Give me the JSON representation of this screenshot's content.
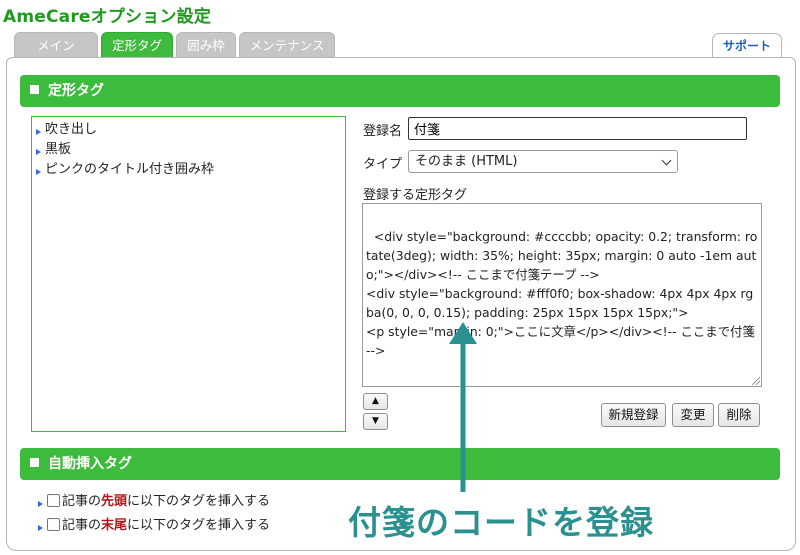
{
  "app": {
    "title": "AmeCareオプション設定"
  },
  "tabs": [
    {
      "label": "メイン",
      "active": false
    },
    {
      "label": "定形タグ",
      "active": true
    },
    {
      "label": "囲み枠",
      "active": false
    },
    {
      "label": "メンテナンス",
      "active": false
    }
  ],
  "support_tab": {
    "label": "サポート"
  },
  "sections": {
    "fixed_tags": {
      "title": "定形タグ"
    },
    "auto_insert": {
      "title": "自動挿入タグ"
    }
  },
  "tag_list": {
    "items": [
      "吹き出し",
      "黒板",
      "ピンクのタイトル付き囲み枠"
    ]
  },
  "form": {
    "name_label": "登録名",
    "name_value": "付箋",
    "type_label": "タイプ",
    "type_value": "そのまま (HTML)",
    "code_label": "登録する定形タグ",
    "code_value": "<div style=\"background: #ccccbb; opacity: 0.2; transform: rotate(3deg); width: 35%; height: 35px; margin: 0 auto -1em auto;\"></div><!-- ここまで付箋テープ -->\n<div style=\"background: #fff0f0; box-shadow: 4px 4px 4px rgba(0, 0, 0, 0.15); padding: 25px 15px 15px 15px;\">\n<p style=\"margin: 0;\">ここに文章</p></div><!-- ここまで付箋 -->"
  },
  "buttons": {
    "move_up": "▲",
    "move_down": "▼",
    "new": "新規登録",
    "change": "変更",
    "delete": "削除"
  },
  "auto_insert": {
    "head": {
      "prefix": "記事の",
      "emph": "先頭",
      "suffix": "に以下のタグを挿入する",
      "checked": false
    },
    "tail": {
      "prefix": "記事の",
      "emph": "末尾",
      "suffix": "に以下のタグを挿入する",
      "checked": false
    }
  },
  "annotation": {
    "text": "付箋のコードを登録",
    "color": "#2a9090"
  },
  "colors": {
    "accent_green": "#3dbb3d",
    "title_green": "#1f9a1f",
    "link_blue": "#1e5fb4",
    "emphasis_red": "#b01818"
  }
}
